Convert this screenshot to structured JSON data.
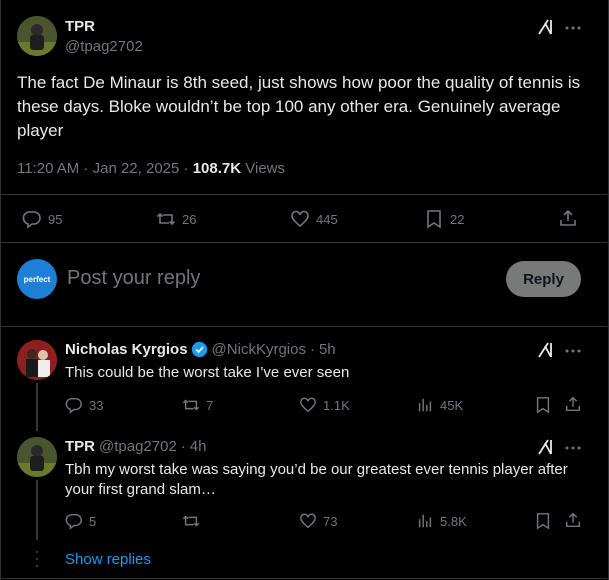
{
  "main_post": {
    "display_name": "TPR",
    "handle": "@tpag2702",
    "text": "The fact De Minaur is 8th seed, just shows how poor the quality of tennis is these days. Bloke wouldn’t be top 100 any other era. Genuinely average player",
    "time": "11:20 AM",
    "date": "Jan 22, 2025",
    "views_count": "108.7K",
    "views_label": "Views",
    "stats": {
      "replies": "95",
      "reposts": "26",
      "likes": "445",
      "bookmarks": "22"
    }
  },
  "reply_box": {
    "avatar_label": "perfect",
    "placeholder": "Post your reply",
    "button_label": "Reply"
  },
  "replies": [
    {
      "display_name": "Nicholas Kyrgios",
      "verified": true,
      "handle": "@NickKyrgios",
      "time": "5h",
      "text": "This could be the worst take I’ve ever seen",
      "stats": {
        "replies": "33",
        "reposts": "7",
        "likes": "1.1K",
        "views": "45K"
      }
    },
    {
      "display_name": "TPR",
      "verified": false,
      "handle": "@tpag2702",
      "time": "4h",
      "text": "Tbh my worst take was saying you’d be our greatest ever tennis player after your first grand slam…",
      "stats": {
        "replies": "5",
        "reposts": "",
        "likes": "73",
        "views": "5.8K"
      }
    }
  ],
  "show_replies_label": "Show replies",
  "colors": {
    "background": "#000000",
    "text": "#e7e9ea",
    "muted": "#71767b",
    "accent": "#1d9bf0",
    "divider": "#2f3336",
    "reply_button": "#787a7a"
  }
}
